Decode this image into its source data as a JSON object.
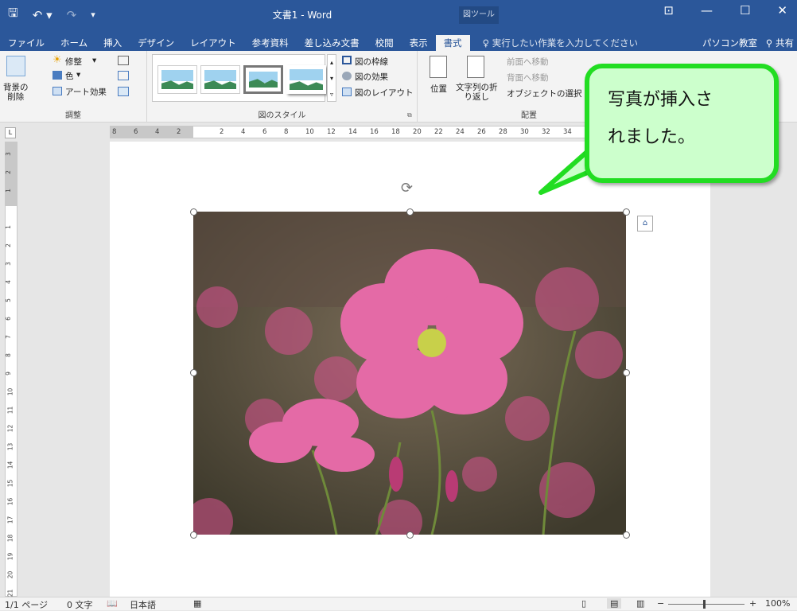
{
  "titlebar": {
    "title": "文書1 - Word",
    "context_tool": "図ツール"
  },
  "tabs": [
    {
      "label": "ファイル"
    },
    {
      "label": "ホーム"
    },
    {
      "label": "挿入"
    },
    {
      "label": "デザイン"
    },
    {
      "label": "レイアウト"
    },
    {
      "label": "参考資料"
    },
    {
      "label": "差し込み文書"
    },
    {
      "label": "校閲"
    },
    {
      "label": "表示"
    },
    {
      "label": "書式"
    }
  ],
  "tellme": "♀ 実行したい作業を入力してください",
  "account": "パソコン教室",
  "share": "共有",
  "ribbon": {
    "remove_bg": "背景の\n削除",
    "corrections": "修整",
    "color": "色",
    "art_effects": "アート効果",
    "group_adjust": "調整",
    "pic_border": "図の枠線",
    "pic_effects": "図の効果",
    "pic_layout": "図のレイアウト",
    "group_styles": "図のスタイル",
    "position": "位置",
    "wrap_text": "文字列の折\nり返し",
    "bring_forward": "前面へ移動",
    "send_backward": "背面へ移動",
    "selection_pane": "オブジェクトの選択",
    "group_arrange": "配置"
  },
  "ruler_top": [
    "8",
    "6",
    "4",
    "2",
    "",
    "2",
    "4",
    "6",
    "8",
    "10",
    "12",
    "14",
    "16",
    "18",
    "20",
    "22",
    "24",
    "26",
    "28",
    "30",
    "32",
    "34",
    "36"
  ],
  "ruler_left": [
    "3",
    "2",
    "1",
    "",
    "1",
    "2",
    "3",
    "4",
    "5",
    "6",
    "7",
    "8",
    "9",
    "10",
    "11",
    "12",
    "13",
    "14",
    "15",
    "16",
    "17",
    "18",
    "19",
    "20",
    "21"
  ],
  "callout": {
    "line1": "写真が挿入さ",
    "line2": "れました。"
  },
  "status": {
    "page": "1/1 ページ",
    "words": "0 文字",
    "lang": "日本語",
    "zoom": "100%"
  },
  "colors": {
    "accent": "#2b579a",
    "callout_fill": "#ccffcc",
    "callout_border": "#22dd22"
  }
}
